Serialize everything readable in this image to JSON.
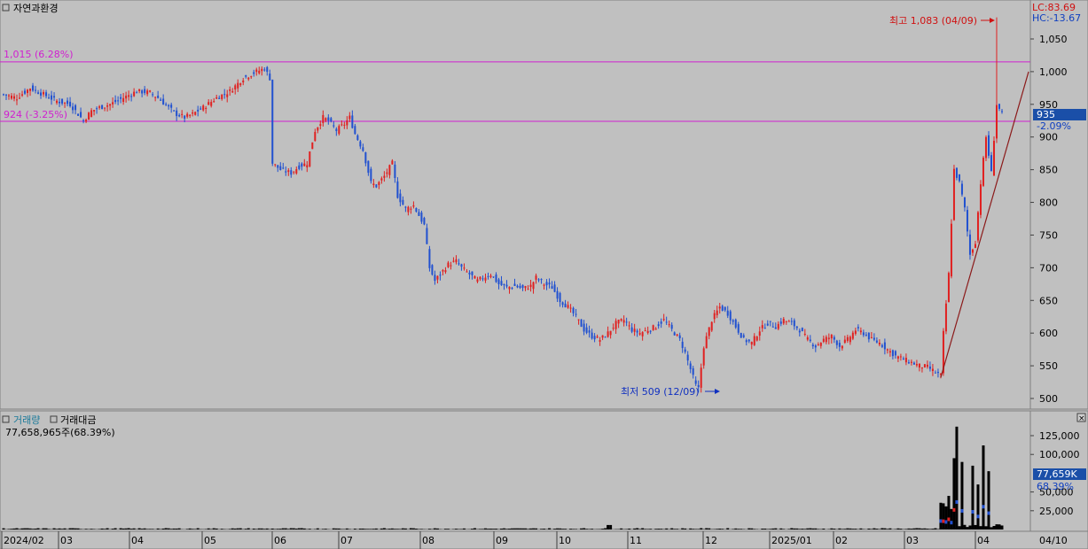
{
  "panel_price": {
    "title": "자연과환경",
    "lc": "LC:83.69",
    "hc": "HC:-13.67",
    "max_annotation": "최고 1,083 (04/09)",
    "min_annotation": "최저 509 (12/09)",
    "current_price": "935",
    "current_change": "-2.09%",
    "h_line_upper": "1,015 (6.28%)",
    "h_line_lower": "924 (-3.25%)",
    "y_ticks": [
      "1,050",
      "1,000",
      "950",
      "900",
      "850",
      "800",
      "750",
      "700",
      "650",
      "600",
      "550",
      "500"
    ]
  },
  "panel_volume": {
    "tab_volume": "거래량",
    "tab_amount": "거래대금",
    "summary": "77,658,965주(68.39%)",
    "current_volume": "77,659K",
    "current_pct": "68.39%",
    "y_ticks": [
      "125,000",
      "100,000",
      "50,000",
      "25,000"
    ]
  },
  "x_axis": {
    "labels": [
      "2024/02",
      "03",
      "04",
      "05",
      "06",
      "07",
      "08",
      "09",
      "10",
      "11",
      "12",
      "2025/01",
      "02",
      "03",
      "04",
      "04/10"
    ]
  },
  "colors": {
    "up": "#e02020",
    "down": "#2050d0",
    "hline": "#d020d0",
    "trend": "#8b1a1a",
    "current_box": "#1a4fa8"
  },
  "chart_data": {
    "type": "candlestick",
    "title": "자연과환경",
    "price_range": [
      490,
      1085
    ],
    "annotations": [
      {
        "label": "최고 1,083 (04/09)",
        "value": 1083
      },
      {
        "label": "최저 509 (12/09)",
        "value": 509
      }
    ],
    "horizontal_lines": [
      {
        "label": "1,015 (6.28%)",
        "value": 1015
      },
      {
        "label": "924 (-3.25%)",
        "value": 924
      }
    ],
    "last_close": 935,
    "last_change_pct": -2.09,
    "close_path": [
      [
        0,
        965
      ],
      [
        5,
        960
      ],
      [
        10,
        975
      ],
      [
        15,
        965
      ],
      [
        20,
        955
      ],
      [
        25,
        950
      ],
      [
        28,
        935
      ],
      [
        30,
        925
      ],
      [
        33,
        940
      ],
      [
        36,
        945
      ],
      [
        40,
        950
      ],
      [
        45,
        960
      ],
      [
        50,
        970
      ],
      [
        55,
        968
      ],
      [
        58,
        960
      ],
      [
        62,
        945
      ],
      [
        65,
        935
      ],
      [
        68,
        930
      ],
      [
        71,
        935
      ],
      [
        75,
        945
      ],
      [
        80,
        960
      ],
      [
        85,
        970
      ],
      [
        90,
        990
      ],
      [
        95,
        1000
      ],
      [
        98,
        1005
      ],
      [
        100,
        990
      ],
      [
        101,
        860
      ],
      [
        104,
        850
      ],
      [
        108,
        845
      ],
      [
        111,
        855
      ],
      [
        114,
        860
      ],
      [
        117,
        910
      ],
      [
        120,
        930
      ],
      [
        122,
        925
      ],
      [
        125,
        910
      ],
      [
        128,
        920
      ],
      [
        130,
        930
      ],
      [
        132,
        905
      ],
      [
        135,
        880
      ],
      [
        138,
        830
      ],
      [
        140,
        825
      ],
      [
        143,
        840
      ],
      [
        146,
        860
      ],
      [
        148,
        810
      ],
      [
        151,
        790
      ],
      [
        154,
        795
      ],
      [
        156,
        780
      ],
      [
        158,
        765
      ],
      [
        160,
        700
      ],
      [
        162,
        680
      ],
      [
        164,
        690
      ],
      [
        167,
        705
      ],
      [
        170,
        710
      ],
      [
        172,
        700
      ],
      [
        175,
        690
      ],
      [
        178,
        680
      ],
      [
        180,
        685
      ],
      [
        183,
        690
      ],
      [
        186,
        675
      ],
      [
        189,
        670
      ],
      [
        192,
        672
      ],
      [
        195,
        668
      ],
      [
        198,
        672
      ],
      [
        200,
        685
      ],
      [
        203,
        675
      ],
      [
        206,
        670
      ],
      [
        209,
        650
      ],
      [
        212,
        640
      ],
      [
        215,
        625
      ],
      [
        218,
        605
      ],
      [
        221,
        595
      ],
      [
        224,
        590
      ],
      [
        227,
        600
      ],
      [
        230,
        615
      ],
      [
        233,
        620
      ],
      [
        236,
        605
      ],
      [
        239,
        600
      ],
      [
        242,
        605
      ],
      [
        245,
        610
      ],
      [
        248,
        620
      ],
      [
        251,
        605
      ],
      [
        254,
        590
      ],
      [
        256,
        570
      ],
      [
        258,
        545
      ],
      [
        260,
        520
      ],
      [
        261,
        515
      ],
      [
        263,
        580
      ],
      [
        266,
        620
      ],
      [
        269,
        640
      ],
      [
        272,
        630
      ],
      [
        275,
        610
      ],
      [
        278,
        590
      ],
      [
        281,
        585
      ],
      [
        284,
        605
      ],
      [
        287,
        615
      ],
      [
        290,
        610
      ],
      [
        293,
        620
      ],
      [
        296,
        615
      ],
      [
        299,
        605
      ],
      [
        302,
        590
      ],
      [
        305,
        580
      ],
      [
        308,
        590
      ],
      [
        311,
        595
      ],
      [
        314,
        580
      ],
      [
        317,
        590
      ],
      [
        320,
        605
      ],
      [
        323,
        600
      ],
      [
        326,
        590
      ],
      [
        329,
        585
      ],
      [
        332,
        575
      ],
      [
        335,
        565
      ],
      [
        338,
        560
      ],
      [
        341,
        555
      ],
      [
        344,
        550
      ],
      [
        347,
        548
      ],
      [
        350,
        540
      ],
      [
        352,
        535
      ],
      [
        353,
        600
      ],
      [
        355,
        690
      ],
      [
        357,
        850
      ],
      [
        359,
        830
      ],
      [
        361,
        790
      ],
      [
        363,
        720
      ],
      [
        365,
        740
      ],
      [
        367,
        830
      ],
      [
        369,
        900
      ],
      [
        371,
        845
      ],
      [
        373,
        950
      ],
      [
        375,
        935
      ]
    ],
    "volume_spikes": [
      {
        "i": 357,
        "v": 95000
      },
      {
        "i": 358,
        "v": 137000
      },
      {
        "i": 360,
        "v": 90000
      },
      {
        "i": 364,
        "v": 85000
      },
      {
        "i": 366,
        "v": 60000
      },
      {
        "i": 368,
        "v": 112000
      },
      {
        "i": 370,
        "v": 77659
      }
    ],
    "volume_range": [
      0,
      140000
    ]
  }
}
